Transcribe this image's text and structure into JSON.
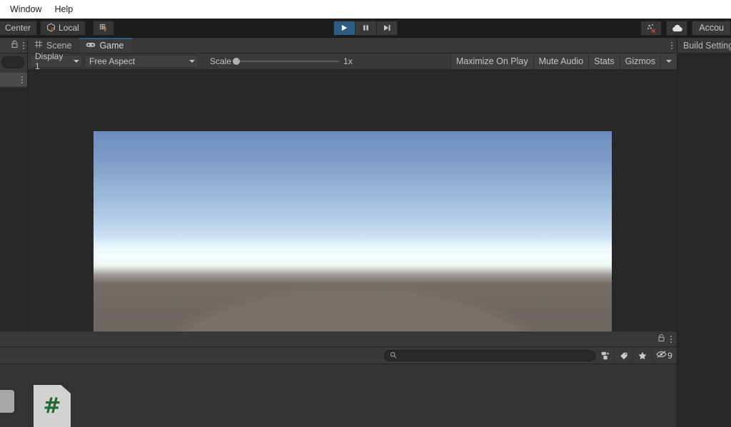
{
  "menubar": {
    "items": [
      {
        "label": "Window"
      },
      {
        "label": "Help"
      }
    ]
  },
  "toolbar": {
    "pivot_label": "Center",
    "handle_label": "Local",
    "grid_snap_icon": "grid-snap-icon",
    "play_icon": "play-icon",
    "pause_icon": "pause-icon",
    "step_icon": "step-icon",
    "play_active": "true",
    "collab_icon": "collab-error-icon",
    "cloud_icon": "cloud-icon",
    "account_label": "Accou",
    "accent_blue": "#2c5d87"
  },
  "hierarchy": {
    "lock_icon": "lock-icon",
    "kebab_icon": "kebab-menu-icon",
    "row_kebab_icon": "kebab-menu-icon",
    "search_placeholder": ""
  },
  "gameview": {
    "tabs": [
      {
        "label": "Scene",
        "icon": "grid-icon",
        "active": false
      },
      {
        "label": "Game",
        "icon": "gamepad-icon",
        "active": true
      }
    ],
    "strip_kebab_icon": "kebab-menu-icon",
    "display_label": "Display 1",
    "aspect_label": "Free Aspect",
    "scale_label": "Scale",
    "scale_value": "1x",
    "scale_percent": 0,
    "maximize_label": "Maximize On Play",
    "mute_label": "Mute Audio",
    "stats_label": "Stats",
    "gizmos_label": "Gizmos",
    "gizmos_caret_icon": "chevron-down-icon",
    "render": {
      "sky_top_color": "#6d8cbe",
      "sky_horizon_color": "#f3fbfd",
      "ground_color": "#756e68"
    }
  },
  "inspector": {
    "build_settings_label": "Build Setting"
  },
  "project": {
    "lock_icon": "lock-icon",
    "kebab_icon": "kebab-menu-icon",
    "search_placeholder": "",
    "search_value": "",
    "search_icon": "search-icon",
    "filter_type_icon": "filter-type-icon",
    "filter_label_icon": "tag-icon",
    "favorites_icon": "star-icon",
    "hidden_icon": "visibility-off-icon",
    "hidden_count": "9",
    "assets": [
      {
        "name": "csharp-script",
        "icon": "csharp-file-icon",
        "glyph": "#"
      }
    ]
  }
}
